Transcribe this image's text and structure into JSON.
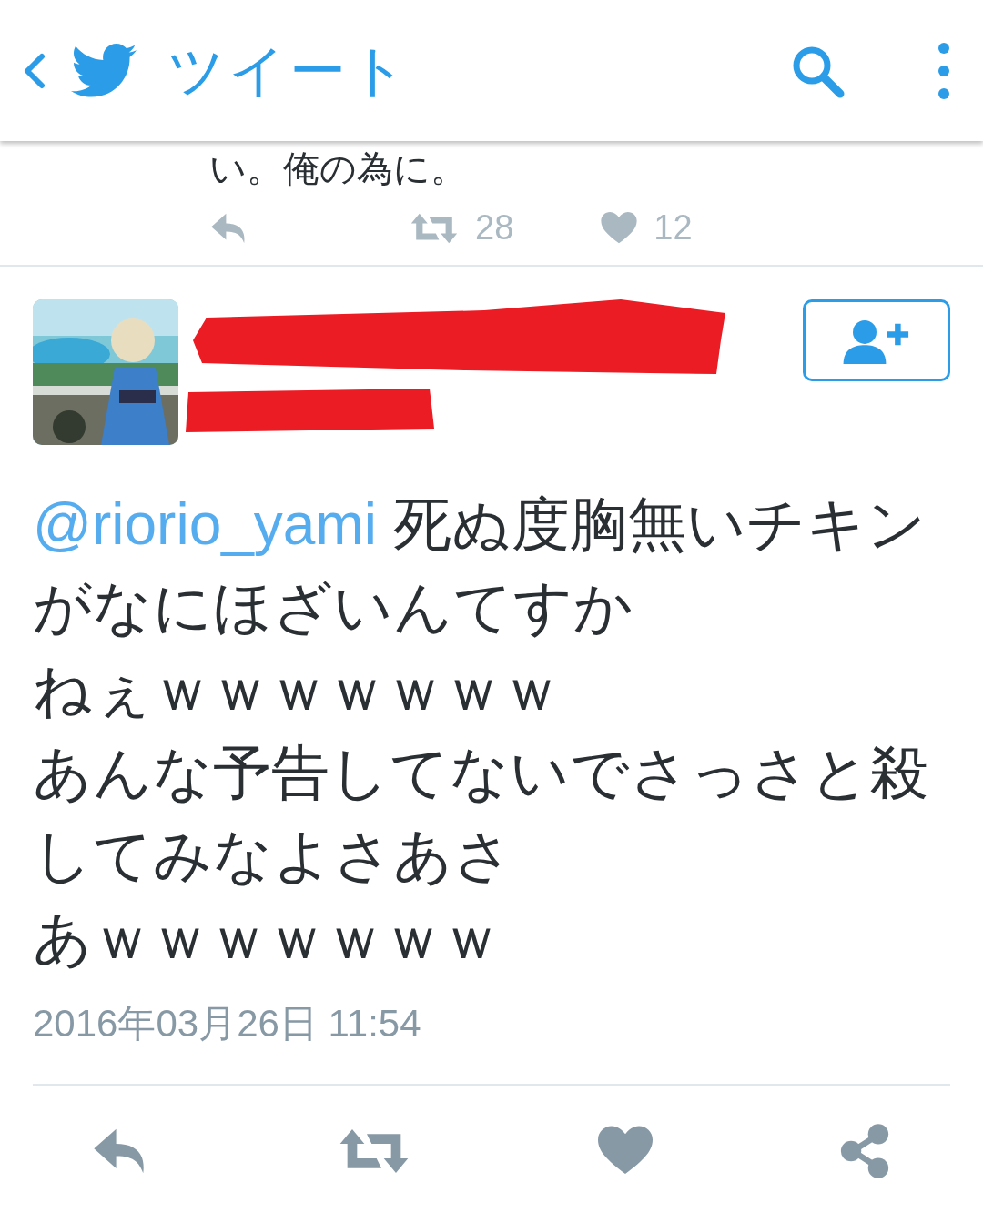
{
  "header": {
    "title": "ツイート"
  },
  "previous_tweet": {
    "text": "い。俺の為に。",
    "retweets": "28",
    "likes": "12"
  },
  "tweet": {
    "mention": "@riorio_yami",
    "lines": [
      "死ぬ度胸無いチキンがなにほざいんてすか",
      "ねぇｗｗｗｗｗｗｗ",
      "あんな予告してないでさっさと殺してみなよさあさ",
      "あｗｗｗｗｗｗｗ"
    ],
    "timestamp": "2016年03月26日 11:54"
  }
}
